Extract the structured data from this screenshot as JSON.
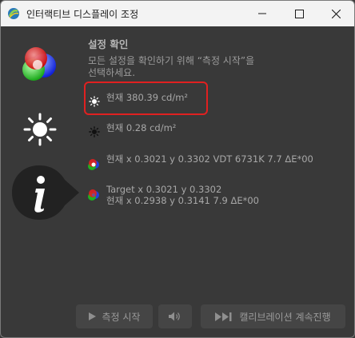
{
  "window": {
    "title": "인터랙티브 디스플레이 조정",
    "icon": "app-logo-icon",
    "controls": [
      "minimize-icon",
      "maximize-icon",
      "close-icon"
    ]
  },
  "sidebar": {
    "items": [
      {
        "name": "rgb-color-icon"
      },
      {
        "name": "brightness-sun-icon"
      },
      {
        "name": "info-icon",
        "selected": true
      }
    ]
  },
  "main": {
    "heading": "설정 확인",
    "description_line1": "모든 설정을 확인하기 위해 “측정 시작”을",
    "description_line2": "선택하세요.",
    "rows": [
      {
        "icon": "white-sun-icon",
        "line1": "현재 380.39 cd/m²"
      },
      {
        "icon": "black-sun-icon",
        "line1": "현재 0.28 cd/m²"
      },
      {
        "icon": "white-point-rgb-icon",
        "line1": "현재 x 0.3021 y 0.3302 VDT 6731K 7.7 ΔE*00"
      },
      {
        "icon": "rgb-target-icon",
        "line1": "Target x 0.3021 y 0.3302",
        "line2": "현재 x 0.2938 y 0.3141 7.9 ΔE*00"
      }
    ]
  },
  "footer": {
    "start_label": "측정 시작",
    "continue_label": "캘리브레이션 계속진행"
  },
  "colors": {
    "background": "#393939",
    "highlight": "#e02020",
    "text": "#a8a8a8"
  }
}
